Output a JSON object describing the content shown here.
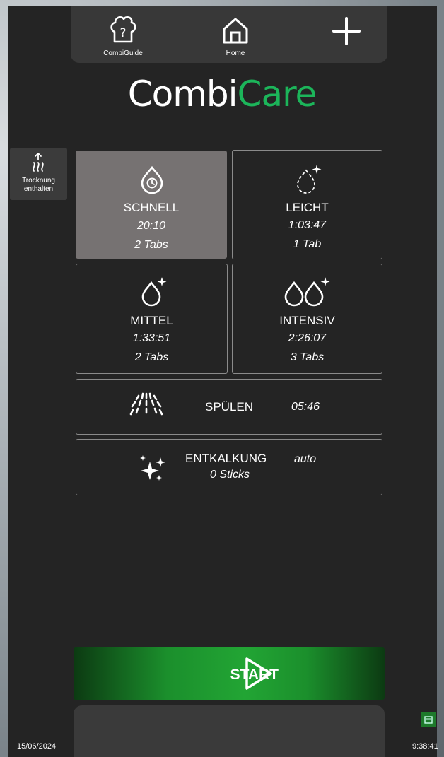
{
  "nav": {
    "combiguide_label": "CombiGuide",
    "home_label": "Home",
    "add_icon": "plus-icon"
  },
  "title": {
    "part1": "Combi",
    "part2": "Care"
  },
  "drying": {
    "label_line1": "Trocknung",
    "label_line2": "enthalten"
  },
  "programs": [
    {
      "name": "SCHNELL",
      "time": "20:10",
      "tabs": "2 Tabs",
      "selected": true
    },
    {
      "name": "LEICHT",
      "time": "1:03:47",
      "tabs": "1 Tab",
      "selected": false
    },
    {
      "name": "MITTEL",
      "time": "1:33:51",
      "tabs": "2 Tabs",
      "selected": false
    },
    {
      "name": "INTENSIV",
      "time": "2:26:07",
      "tabs": "3 Tabs",
      "selected": false
    }
  ],
  "rinse": {
    "name": "SPÜLEN",
    "time": "05:46"
  },
  "descale": {
    "name": "ENTKALKUNG",
    "mode": "auto",
    "sticks": "0 Sticks"
  },
  "start": {
    "label": "START"
  },
  "footer": {
    "date": "15/06/2024",
    "time": "9:38:41"
  },
  "colors": {
    "accent_green": "#1cb55a",
    "start_green": "#22a534",
    "selected_tile": "#767272",
    "background": "#242424"
  }
}
